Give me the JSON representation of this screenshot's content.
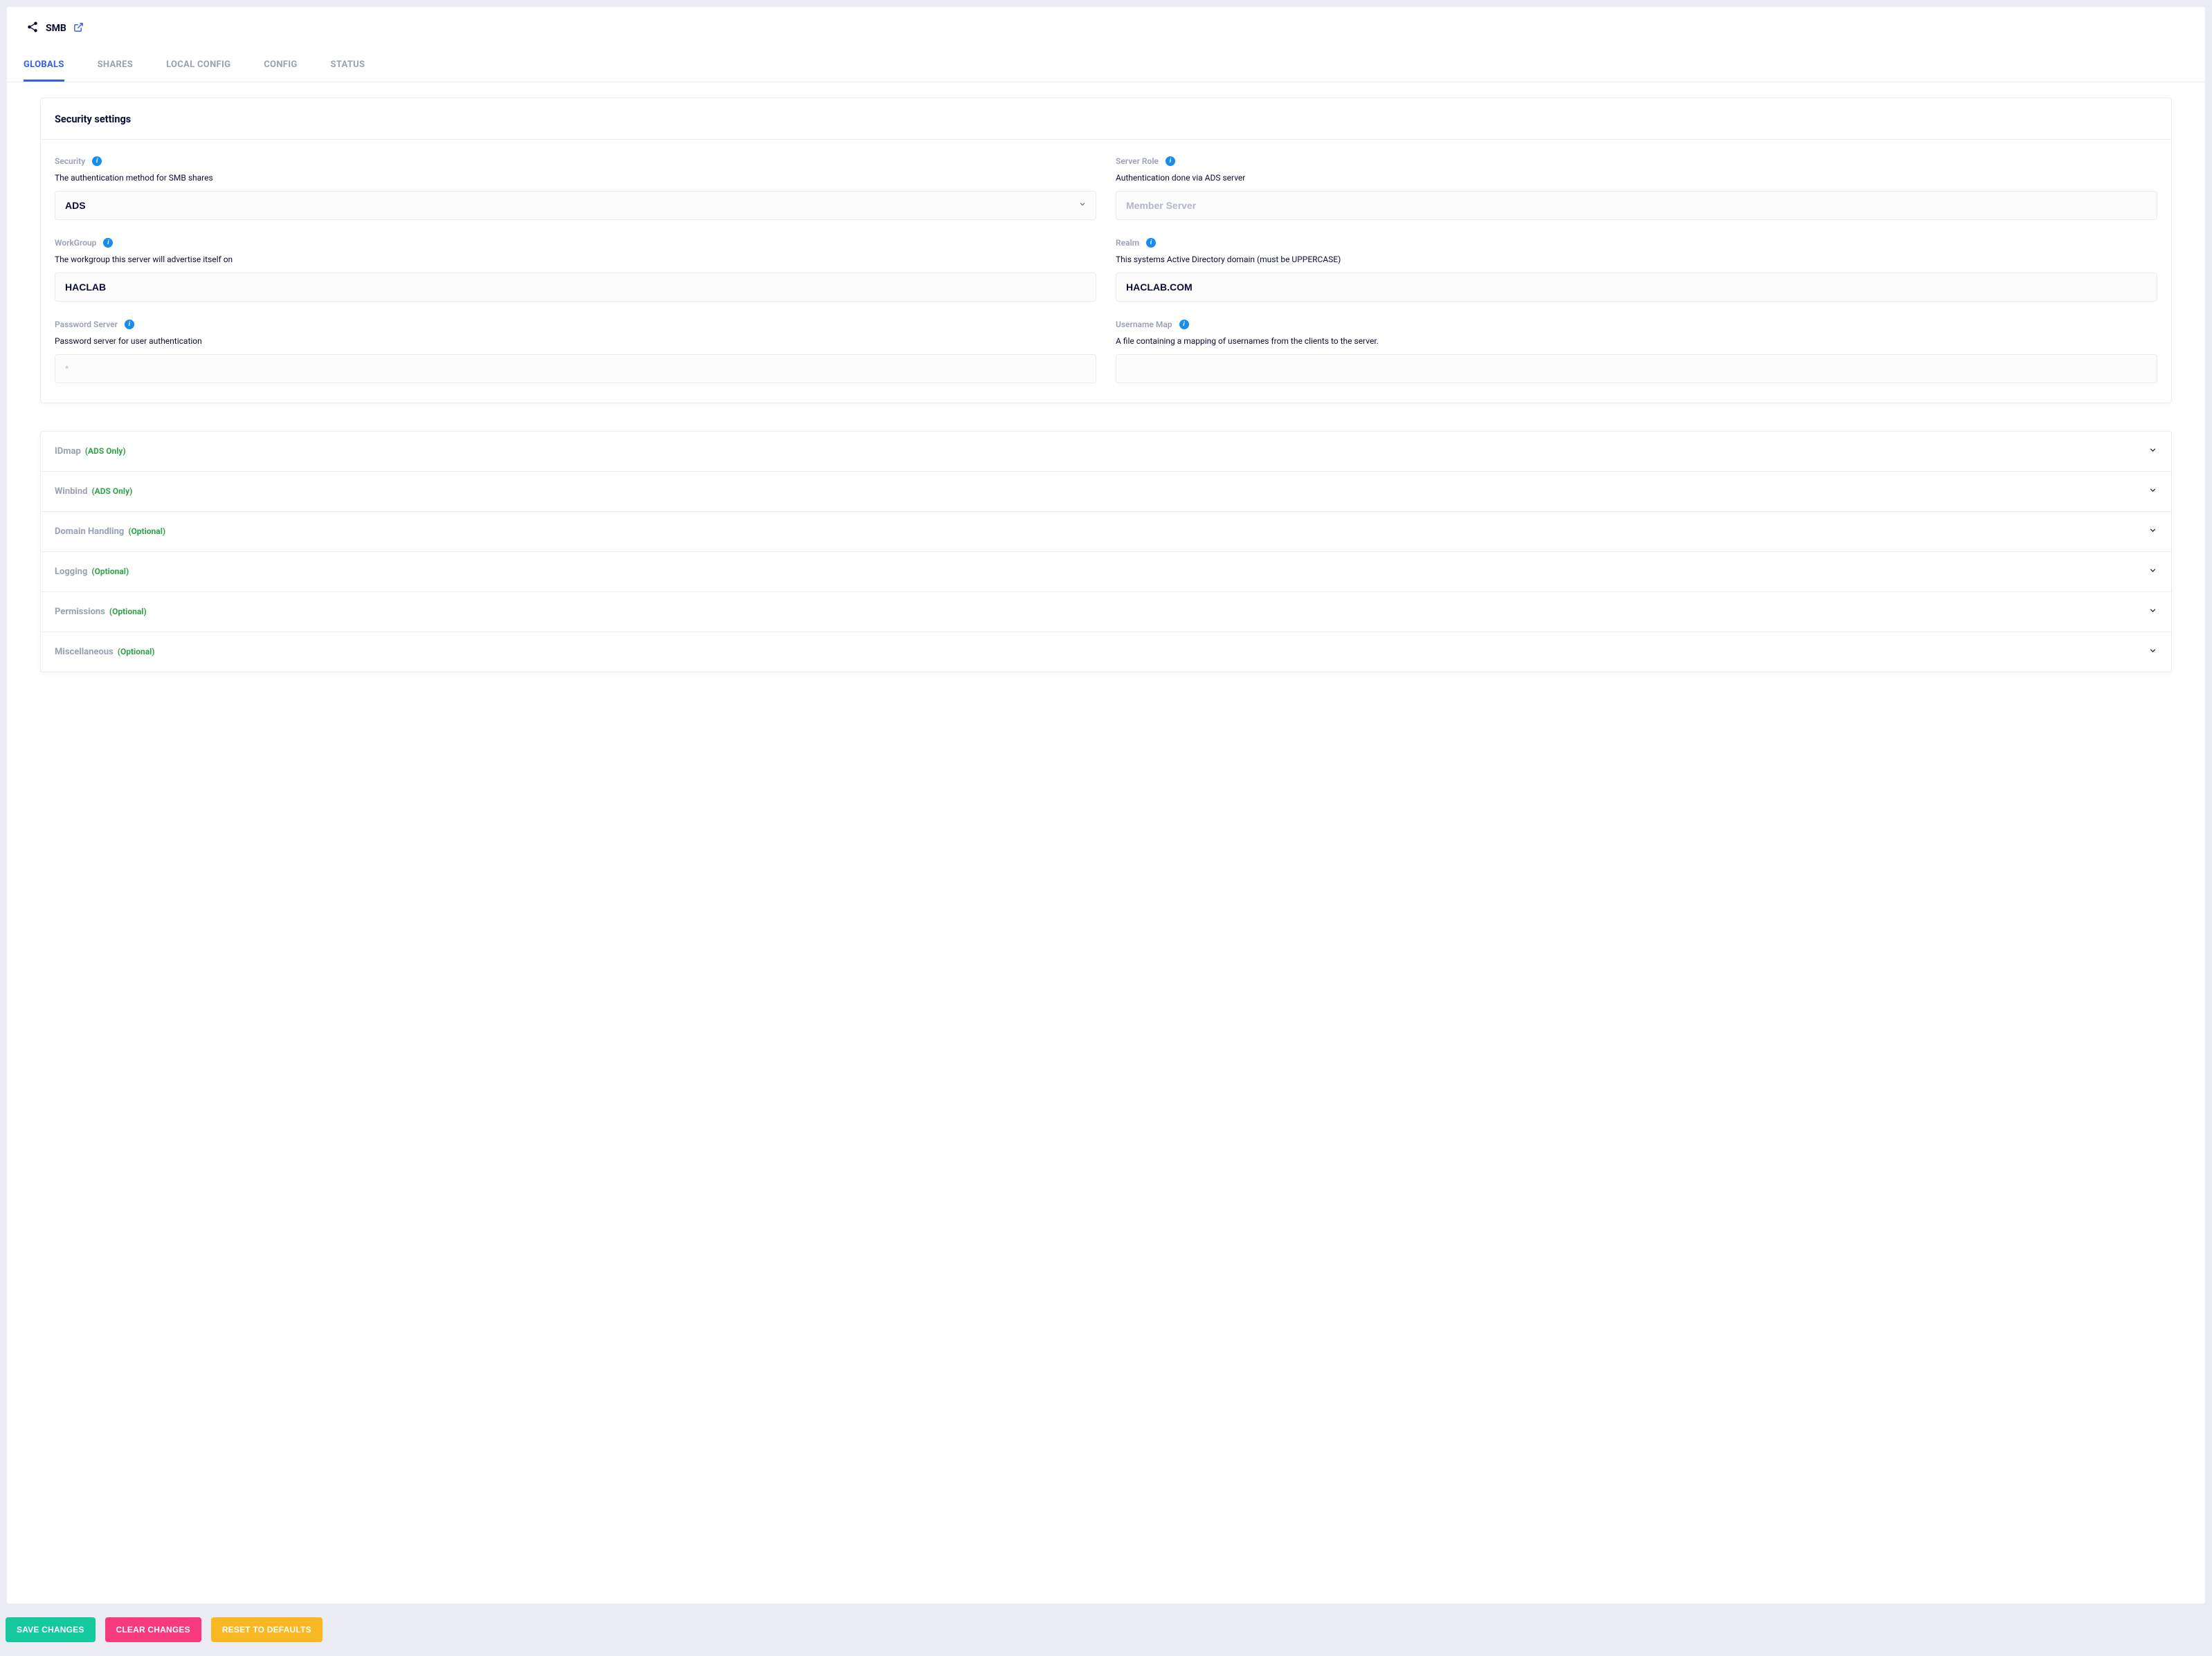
{
  "header": {
    "title": "SMB"
  },
  "tabs": [
    {
      "id": "globals",
      "label": "GLOBALS",
      "active": true
    },
    {
      "id": "shares",
      "label": "SHARES",
      "active": false
    },
    {
      "id": "local-config",
      "label": "LOCAL CONFIG",
      "active": false
    },
    {
      "id": "config",
      "label": "CONFIG",
      "active": false
    },
    {
      "id": "status",
      "label": "STATUS",
      "active": false
    }
  ],
  "security_card": {
    "title": "Security settings",
    "fields": {
      "security": {
        "label": "Security",
        "help": "The authentication method for SMB shares",
        "value": "ADS"
      },
      "server_role": {
        "label": "Server Role",
        "help": "Authentication done via ADS server",
        "value": "Member Server"
      },
      "workgroup": {
        "label": "WorkGroup",
        "help": "The workgroup this server will advertise itself on",
        "value": "HACLAB"
      },
      "realm": {
        "label": "Realm",
        "help": "This systems Active Directory domain (must be UPPERCASE)",
        "value": "HACLAB.COM"
      },
      "password_server": {
        "label": "Password Server",
        "help": "Password server for user authentication",
        "value": "",
        "placeholder": "*"
      },
      "username_map": {
        "label": "Username Map",
        "help": "A file containing a mapping of usernames from the clients to the server.",
        "value": ""
      }
    }
  },
  "accordion": [
    {
      "id": "idmap",
      "title": "IDmap",
      "tag": "(ADS Only)"
    },
    {
      "id": "winbind",
      "title": "Winbind",
      "tag": "(ADS Only)"
    },
    {
      "id": "domain-handling",
      "title": "Domain Handling",
      "tag": "(Optional)"
    },
    {
      "id": "logging",
      "title": "Logging",
      "tag": "(Optional)"
    },
    {
      "id": "permissions",
      "title": "Permissions",
      "tag": "(Optional)"
    },
    {
      "id": "misc",
      "title": "Miscellaneous",
      "tag": "(Optional)"
    }
  ],
  "footer": {
    "save": "SAVE CHANGES",
    "clear": "CLEAR CHANGES",
    "reset": "RESET TO DEFAULTS"
  }
}
